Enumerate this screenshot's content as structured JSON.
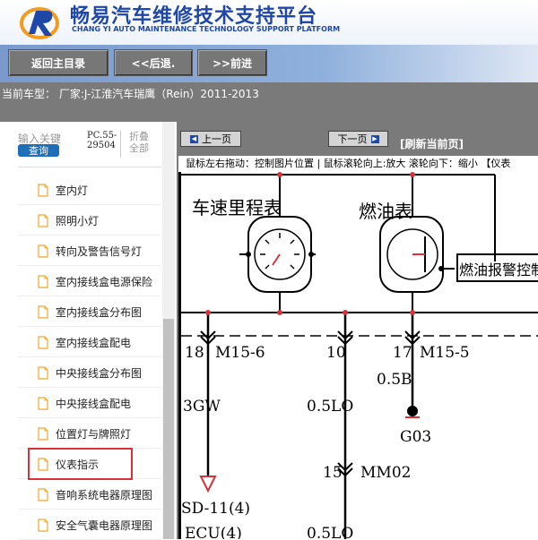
{
  "header": {
    "title_cn": "畅易汽车维修技术支持平台",
    "title_en": "CHANG YI AUTO MAINTENANCE TECHNOLOGY SUPPORT PLATFORM"
  },
  "toolbar": {
    "home_label": "返回主目录",
    "back_label": "<<后退.",
    "forward_label": ">>前进"
  },
  "model": {
    "text": "当前车型：  厂家:J-江淮汽车瑞鹰（Rein）2011-2013"
  },
  "sidebar": {
    "search_label": "输入关键",
    "search_button": "查询",
    "code_line1": "PC.55-",
    "code_line2": "29504",
    "collapse_line1": "折叠",
    "collapse_line2": "全部",
    "items": [
      {
        "label": "室内灯"
      },
      {
        "label": "照明小灯"
      },
      {
        "label": "转向及警告信号灯"
      },
      {
        "label": "室内接线盒电源保险"
      },
      {
        "label": "室内接线盒分布图"
      },
      {
        "label": "室内接线盒配电"
      },
      {
        "label": "中央接线盒分布图"
      },
      {
        "label": "中央接线盒配电"
      },
      {
        "label": "位置灯与牌照灯"
      },
      {
        "label": "仪表指示"
      },
      {
        "label": "音响系统电器原理图"
      },
      {
        "label": "安全气囊电器原理图"
      }
    ]
  },
  "viewer": {
    "prev_label": "上一页",
    "next_label": "下一页",
    "refresh_label": "[刷新当前页]",
    "hint": "鼠标左右拖动：控制图片位置 | 鼠标滚轮向上:放大   滚轮向下：缩小 【仪表"
  },
  "diagram": {
    "speedometer": "车速里程表",
    "fuel_gauge": "燃油表",
    "fuel_warning": "燃油报警控制",
    "pin1": "18",
    "pin1_conn": "M15-6",
    "pin2": "10",
    "pin3": "17",
    "pin3_conn": "M15-5",
    "wire_gw": "3GW",
    "wire_lo": "0.5LO",
    "wire_b": "0.5B",
    "ground": "G03",
    "splice_num": "15",
    "splice": "MM02",
    "bottom_conn": "SD-11(4)",
    "bottom_ecu": "ECU(4)",
    "bottom_wire": "0.5LO"
  },
  "colors": {
    "brand_blue": "#1f47a8",
    "toolbar_bg": "#8fb0dc",
    "model_bar": "#7a7a7a",
    "highlight": "#d9303a",
    "search_button": "#1e6fb8"
  }
}
